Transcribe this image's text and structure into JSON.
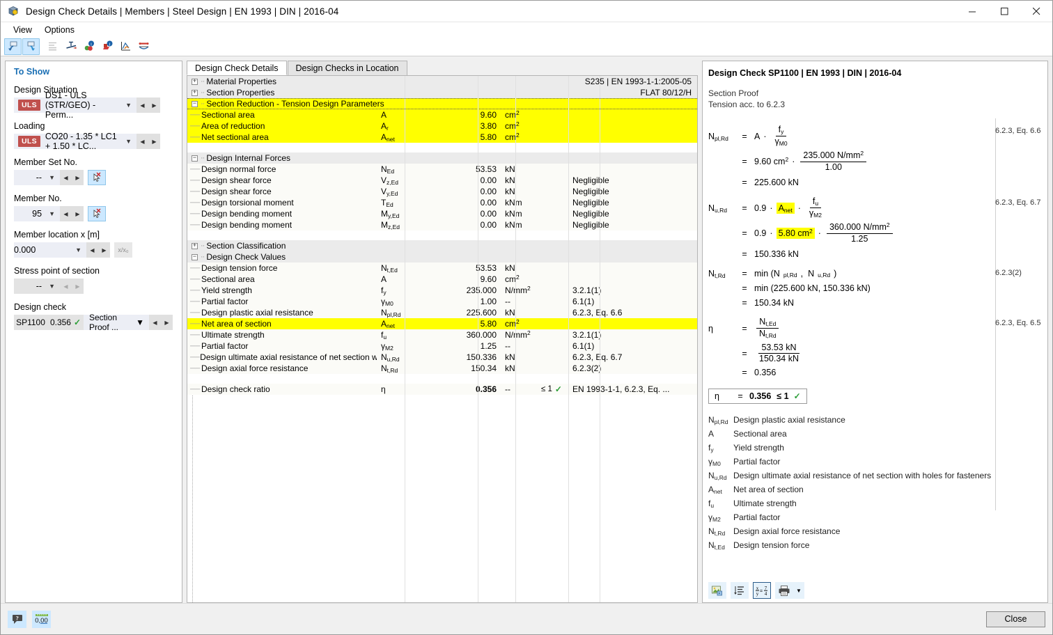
{
  "window": {
    "title": "Design Check Details | Members | Steel Design | EN 1993 | DIN | 2016-04",
    "app_icon": "cube-icon",
    "minimize": "—",
    "maximize": "☐",
    "close": "✕"
  },
  "menubar": {
    "items": [
      "View",
      "Options"
    ]
  },
  "toolbar": {
    "buttons": [
      {
        "name": "undo-arrow-icon",
        "active": true
      },
      {
        "name": "redo-arrow-icon",
        "active": true
      },
      {
        "name": "list-align-icon",
        "active": false,
        "disabled": true
      },
      {
        "name": "section-profile-icon",
        "active": false
      },
      {
        "name": "info-circle-green-icon",
        "active": false
      },
      {
        "name": "info-circle-red-icon",
        "active": false
      },
      {
        "name": "chart-curve-icon",
        "active": false
      },
      {
        "name": "beam-diagram-icon",
        "active": false
      }
    ]
  },
  "sidebar": {
    "heading": "To Show",
    "design_situation": {
      "label": "Design Situation",
      "badge": "ULS",
      "value": "DS1 - ULS (STR/GEO) - Perm..."
    },
    "loading": {
      "label": "Loading",
      "badge": "ULS",
      "value": "CO20 - 1.35 * LC1 + 1.50 * LC..."
    },
    "member_set": {
      "label": "Member Set No.",
      "value": "--"
    },
    "member_no": {
      "label": "Member No.",
      "value": "95"
    },
    "member_location": {
      "label": "Member location x [m]",
      "value": "0.000",
      "ratio_button": "x/x₀"
    },
    "stress_point": {
      "label": "Stress point of section",
      "value": "--"
    },
    "design_check": {
      "label": "Design check",
      "id": "SP1100",
      "ratio": "0.356",
      "status": "✓",
      "description": "Section Proof ..."
    }
  },
  "tabs": [
    {
      "label": "Design Check Details",
      "selected": true
    },
    {
      "label": "Design Checks in Location",
      "selected": false
    }
  ],
  "table": {
    "groups": [
      {
        "name": "Material Properties",
        "expanded": false,
        "right_value": "S235 | EN 1993-1-1:2005-05",
        "highlight": false,
        "rows": []
      },
      {
        "name": "Section Properties",
        "expanded": false,
        "right_value": "FLAT 80/12/H",
        "highlight": false,
        "rows": []
      },
      {
        "name": "Section Reduction - Tension Design Parameters",
        "expanded": true,
        "right_value": "",
        "highlight": true,
        "rows": [
          {
            "label": "Sectional area",
            "sym": "A",
            "sym_sub": "",
            "value": "9.60",
            "unit": "cm",
            "unit_sup": "2",
            "check": "",
            "note": "",
            "highlight": true
          },
          {
            "label": "Area of reduction",
            "sym": "A",
            "sym_sub": "r",
            "value": "3.80",
            "unit": "cm",
            "unit_sup": "2",
            "check": "",
            "note": "",
            "highlight": true
          },
          {
            "label": "Net sectional area",
            "sym": "A",
            "sym_sub": "net",
            "value": "5.80",
            "unit": "cm",
            "unit_sup": "2",
            "check": "",
            "note": "",
            "highlight": true
          }
        ]
      },
      {
        "name": "Design Internal Forces",
        "expanded": true,
        "right_value": "",
        "highlight": false,
        "rows": [
          {
            "label": "Design normal force",
            "sym": "N",
            "sym_sub": "Ed",
            "value": "53.53",
            "unit": "kN",
            "unit_sup": "",
            "check": "",
            "note": "",
            "highlight": false
          },
          {
            "label": "Design shear force",
            "sym": "V",
            "sym_sub": "z,Ed",
            "value": "0.00",
            "unit": "kN",
            "unit_sup": "",
            "check": "",
            "note": "Negligible",
            "highlight": false
          },
          {
            "label": "Design shear force",
            "sym": "V",
            "sym_sub": "y,Ed",
            "value": "0.00",
            "unit": "kN",
            "unit_sup": "",
            "check": "",
            "note": "Negligible",
            "highlight": false
          },
          {
            "label": "Design torsional moment",
            "sym": "T",
            "sym_sub": "Ed",
            "value": "0.00",
            "unit": "kNm",
            "unit_sup": "",
            "check": "",
            "note": "Negligible",
            "highlight": false
          },
          {
            "label": "Design bending moment",
            "sym": "M",
            "sym_sub": "y,Ed",
            "value": "0.00",
            "unit": "kNm",
            "unit_sup": "",
            "check": "",
            "note": "Negligible",
            "highlight": false
          },
          {
            "label": "Design bending moment",
            "sym": "M",
            "sym_sub": "z,Ed",
            "value": "0.00",
            "unit": "kNm",
            "unit_sup": "",
            "check": "",
            "note": "Negligible",
            "highlight": false
          }
        ]
      },
      {
        "name": "Section Classification",
        "expanded": false,
        "right_value": "",
        "highlight": false,
        "rows": []
      },
      {
        "name": "Design Check Values",
        "expanded": true,
        "right_value": "",
        "highlight": false,
        "rows": [
          {
            "label": "Design tension force",
            "sym": "N",
            "sym_sub": "t,Ed",
            "value": "53.53",
            "unit": "kN",
            "unit_sup": "",
            "check": "",
            "note": "",
            "highlight": false
          },
          {
            "label": "Sectional area",
            "sym": "A",
            "sym_sub": "",
            "value": "9.60",
            "unit": "cm",
            "unit_sup": "2",
            "check": "",
            "note": "",
            "highlight": false
          },
          {
            "label": "Yield strength",
            "sym": "f",
            "sym_sub": "y",
            "value": "235.000",
            "unit": "N/mm",
            "unit_sup": "2",
            "check": "",
            "note": "3.2.1(1)",
            "highlight": false
          },
          {
            "label": "Partial factor",
            "sym": "γ",
            "sym_sub": "M0",
            "value": "1.00",
            "unit": "--",
            "unit_sup": "",
            "check": "",
            "note": "6.1(1)",
            "highlight": false
          },
          {
            "label": "Design plastic axial resistance",
            "sym": "N",
            "sym_sub": "pl,Rd",
            "value": "225.600",
            "unit": "kN",
            "unit_sup": "",
            "check": "",
            "note": "6.2.3, Eq. 6.6",
            "highlight": false
          },
          {
            "label": "Net area of section",
            "sym": "A",
            "sym_sub": "net",
            "value": "5.80",
            "unit": "cm",
            "unit_sup": "2",
            "check": "",
            "note": "",
            "highlight": true
          },
          {
            "label": "Ultimate strength",
            "sym": "f",
            "sym_sub": "u",
            "value": "360.000",
            "unit": "N/mm",
            "unit_sup": "2",
            "check": "",
            "note": "3.2.1(1)",
            "highlight": false
          },
          {
            "label": "Partial factor",
            "sym": "γ",
            "sym_sub": "M2",
            "value": "1.25",
            "unit": "--",
            "unit_sup": "",
            "check": "",
            "note": "6.1(1)",
            "highlight": false
          },
          {
            "label": "Design ultimate axial resistance of net section with h...",
            "sym": "N",
            "sym_sub": "u,Rd",
            "value": "150.336",
            "unit": "kN",
            "unit_sup": "",
            "check": "",
            "note": "6.2.3, Eq. 6.7",
            "highlight": false
          },
          {
            "label": "Design axial force resistance",
            "sym": "N",
            "sym_sub": "t,Rd",
            "value": "150.34",
            "unit": "kN",
            "unit_sup": "",
            "check": "",
            "note": "6.2.3(2)",
            "highlight": false
          }
        ]
      }
    ],
    "final_row": {
      "label": "Design check ratio",
      "sym": "η",
      "sym_sub": "",
      "value": "0.356",
      "unit": "--",
      "unit_sup": "",
      "check_limit": "≤ 1",
      "check_mark": "✓",
      "note": "EN 1993-1-1, 6.2.3, Eq. ..."
    }
  },
  "detail": {
    "title": "Design Check SP1100 | EN 1993 | DIN | 2016-04",
    "subtitle_line1": "Section Proof",
    "subtitle_line2": "Tension acc. to 6.2.3",
    "equations": [
      {
        "id": "npl",
        "lhs_base": "N",
        "lhs_sub": "pl,Rd",
        "ref": "6.2.3, Eq. 6.6",
        "lines": [
          {
            "type": "symbolic",
            "factor": "A",
            "num_base": "f",
            "num_sub": "y",
            "den_base": "γ",
            "den_sub": "M0"
          },
          {
            "type": "numeric",
            "factor": "9.60 cm²",
            "num": "235.000 N/mm²",
            "den": "1.00"
          },
          {
            "type": "result",
            "value": "225.600 kN"
          }
        ]
      },
      {
        "id": "nu",
        "lhs_base": "N",
        "lhs_sub": "u,Rd",
        "ref": "6.2.3, Eq. 6.7",
        "lines": [
          {
            "type": "symbolic_hl",
            "coef": "0.9",
            "factor_hl": "A",
            "factor_hl_sub": "net",
            "num_base": "f",
            "num_sub": "u",
            "den_base": "γ",
            "den_sub": "M2"
          },
          {
            "type": "numeric_hl",
            "coef": "0.9",
            "factor_hl": "5.80 cm²",
            "num": "360.000 N/mm²",
            "den": "1.25"
          },
          {
            "type": "result",
            "value": "150.336 kN"
          }
        ]
      },
      {
        "id": "nt",
        "lhs_base": "N",
        "lhs_sub": "t,Rd",
        "ref": "6.2.3(2)",
        "lines": [
          {
            "type": "text",
            "value": "min (Nₚₗ,ᴿᵈ ,  Nᵤ,ᴿᵈ)",
            "sym_min": true
          },
          {
            "type": "text",
            "value": "min (225.600 kN,  150.336 kN)"
          },
          {
            "type": "result",
            "value": "150.34 kN"
          }
        ]
      },
      {
        "id": "eta",
        "lhs_base": "η",
        "lhs_sub": "",
        "ref": "6.2.3, Eq. 6.5",
        "lines": [
          {
            "type": "frac_sym",
            "num_base": "N",
            "num_sub": "t,Ed",
            "den_base": "N",
            "den_sub": "t,Rd"
          },
          {
            "type": "frac_num",
            "num": "53.53 kN",
            "den": "150.34 kN"
          },
          {
            "type": "result",
            "value": "0.356"
          }
        ]
      }
    ],
    "result_box": {
      "sym": "η",
      "eq": "=",
      "value": "0.356",
      "limit": "≤ 1",
      "mark": "✓"
    },
    "legend": [
      {
        "sym_base": "N",
        "sym_sub": "pl,Rd",
        "text": "Design plastic axial resistance"
      },
      {
        "sym_base": "A",
        "sym_sub": "",
        "text": "Sectional area"
      },
      {
        "sym_base": "f",
        "sym_sub": "y",
        "text": "Yield strength"
      },
      {
        "sym_base": "γ",
        "sym_sub": "M0",
        "text": "Partial factor"
      },
      {
        "sym_base": "N",
        "sym_sub": "u,Rd",
        "text": "Design ultimate axial resistance of net section with holes for fasteners"
      },
      {
        "sym_base": "A",
        "sym_sub": "net",
        "text": "Net area of section"
      },
      {
        "sym_base": "f",
        "sym_sub": "u",
        "text": "Ultimate strength"
      },
      {
        "sym_base": "γ",
        "sym_sub": "M2",
        "text": "Partial factor"
      },
      {
        "sym_base": "N",
        "sym_sub": "t,Rd",
        "text": "Design axial force resistance"
      },
      {
        "sym_base": "N",
        "sym_sub": "t,Ed",
        "text": "Design tension force"
      }
    ],
    "toolbar": [
      {
        "name": "image-export-icon"
      },
      {
        "name": "list-numbered-icon"
      },
      {
        "name": "formula-fraction-icon",
        "framed": true
      },
      {
        "name": "printer-icon"
      }
    ]
  },
  "statusbar": {
    "help_icon": "help-bubble-icon",
    "decimals_icon": "decimal-places-icon",
    "close_label": "Close"
  },
  "colors": {
    "highlight_yellow": "#ffff00",
    "uls_badge": "#c0504d",
    "accent_blue": "#1a6fb4",
    "check_green": "#2a9d36"
  }
}
